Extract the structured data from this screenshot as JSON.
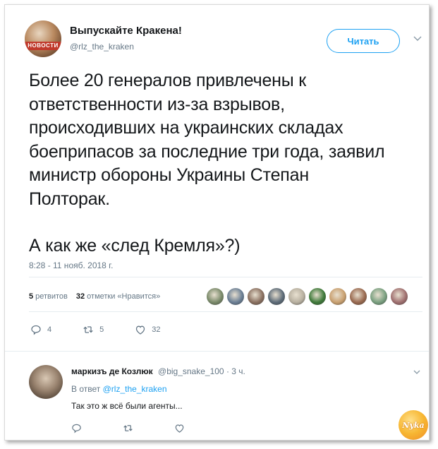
{
  "author": {
    "display_name": "Выпускайте Кракена!",
    "handle": "@rlz_the_kraken",
    "avatar_badge": "НОВОСТИ"
  },
  "follow_button": {
    "label": "Читать"
  },
  "tweet": {
    "paragraph_1": "Более 20 генералов привлечены к\nответственности из-за взрывов,\nпроисходивших на украинских складах\nбоеприпасов за последние три года, заявил\nминистр обороны Украины Степан\nПолторак.",
    "paragraph_2": "А как же «след Кремля»?)",
    "timestamp": "8:28 - 11 нояб. 2018 г."
  },
  "stats": {
    "retweets_count": "5",
    "retweets_label": "ретвитов",
    "likes_count": "32",
    "likes_label": "отметки «Нравится»"
  },
  "liker_colors": [
    "#7a8a6a",
    "#6b7f95",
    "#8a7060",
    "#5d6b78",
    "#b8b0a0",
    "#3f7a3a",
    "#c9a070",
    "#9a6a50",
    "#7aa080",
    "#a07070"
  ],
  "actions": {
    "replies": "4",
    "retweets": "5",
    "likes": "32"
  },
  "reply": {
    "name": "маркизъ де Козлюк",
    "handle": "@big_snake_100",
    "time": "· 3 ч.",
    "reply_to_prefix": "В ответ",
    "reply_to_handle": "@rlz_the_kraken",
    "text": "Так это ж всё были агенты..."
  },
  "watermark": {
    "text": "Nyka"
  },
  "colors": {
    "accent": "#1da1f2",
    "muted": "#657786",
    "text": "#14171a"
  }
}
